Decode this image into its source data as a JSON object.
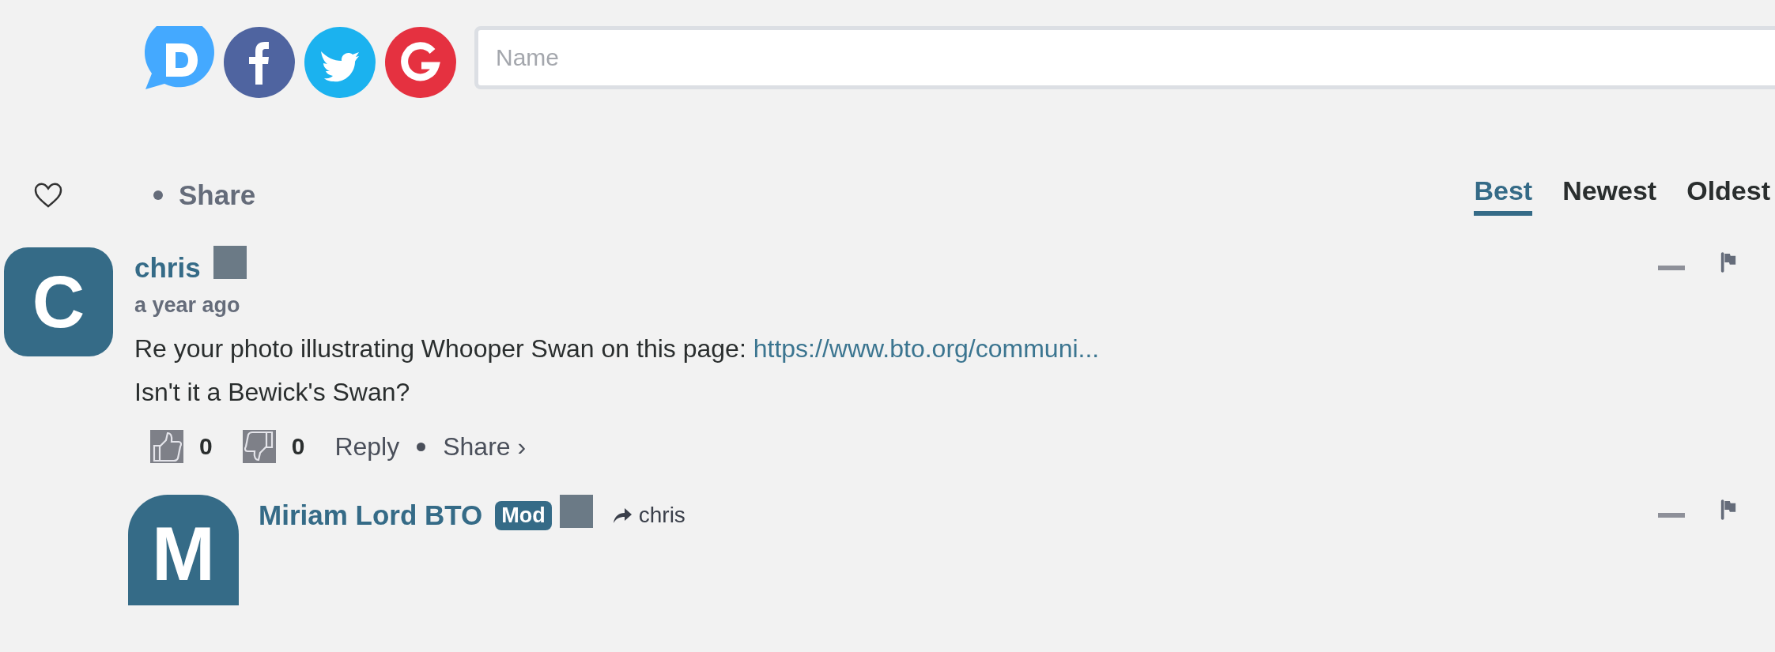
{
  "login": {
    "services": [
      {
        "kind": "disqus"
      },
      {
        "kind": "facebook"
      },
      {
        "kind": "twitter"
      },
      {
        "kind": "google"
      }
    ],
    "name_field": {
      "placeholder": "Name"
    }
  },
  "toolbar": {
    "share": "Share",
    "sort_tabs": [
      {
        "label": "Best",
        "selected": true
      },
      {
        "label": "Newest",
        "selected": false
      },
      {
        "label": "Oldest",
        "selected": false
      }
    ]
  },
  "comments": [
    {
      "avatar_letter": "C",
      "author": "chris",
      "time": "a year ago",
      "text_lines": [
        "Re your photo illustrating Whooper Swan on this page:",
        "Isn't it a Bewick's Swan?"
      ],
      "link": "https://www.bto.org/communi...",
      "upvotes": "0",
      "downvotes": "0",
      "reply": "Reply",
      "share": "Share ›",
      "replies": [
        {
          "avatar_letter": "M",
          "author": "Miriam Lord BTO",
          "badge": "Mod",
          "reply_to": "chris"
        }
      ]
    }
  ]
}
